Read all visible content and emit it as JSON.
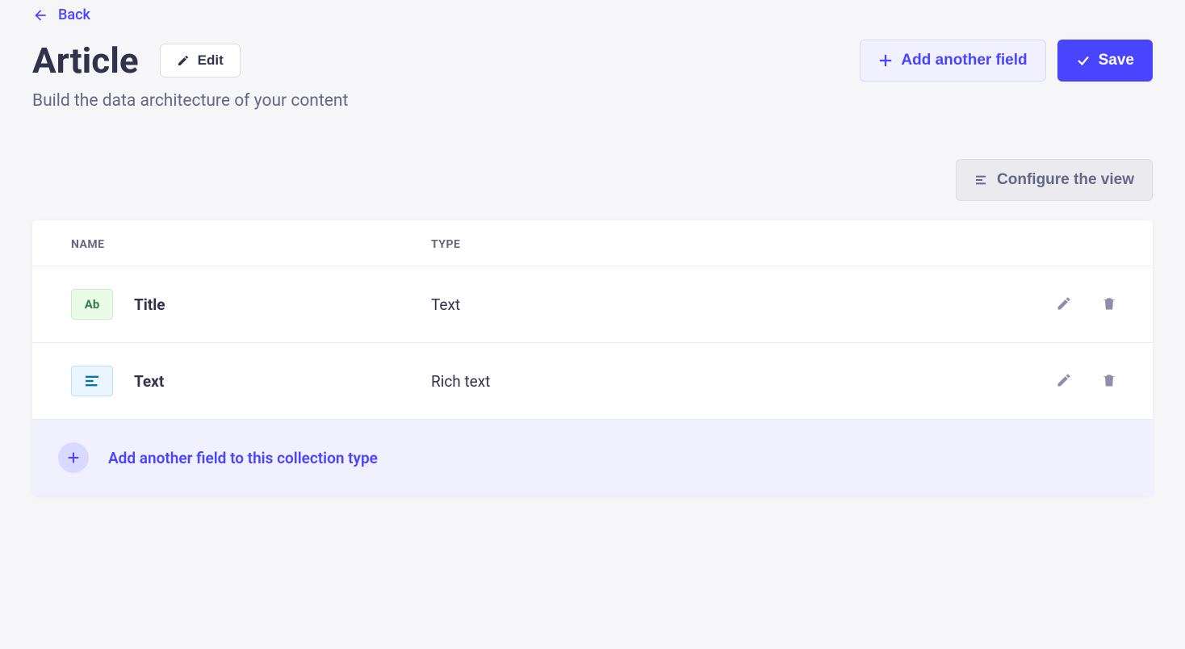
{
  "back": {
    "label": "Back"
  },
  "header": {
    "title": "Article",
    "edit_label": "Edit",
    "subtitle": "Build the data architecture of your content"
  },
  "actions": {
    "add_field_label": "Add another field",
    "save_label": "Save",
    "configure_label": "Configure the view"
  },
  "table": {
    "columns": {
      "name": "NAME",
      "type": "TYPE"
    },
    "rows": [
      {
        "icon_text": "Ab",
        "name": "Title",
        "type": "Text"
      },
      {
        "name": "Text",
        "type": "Rich text"
      }
    ]
  },
  "footer": {
    "add_label": "Add another field to this collection type"
  }
}
